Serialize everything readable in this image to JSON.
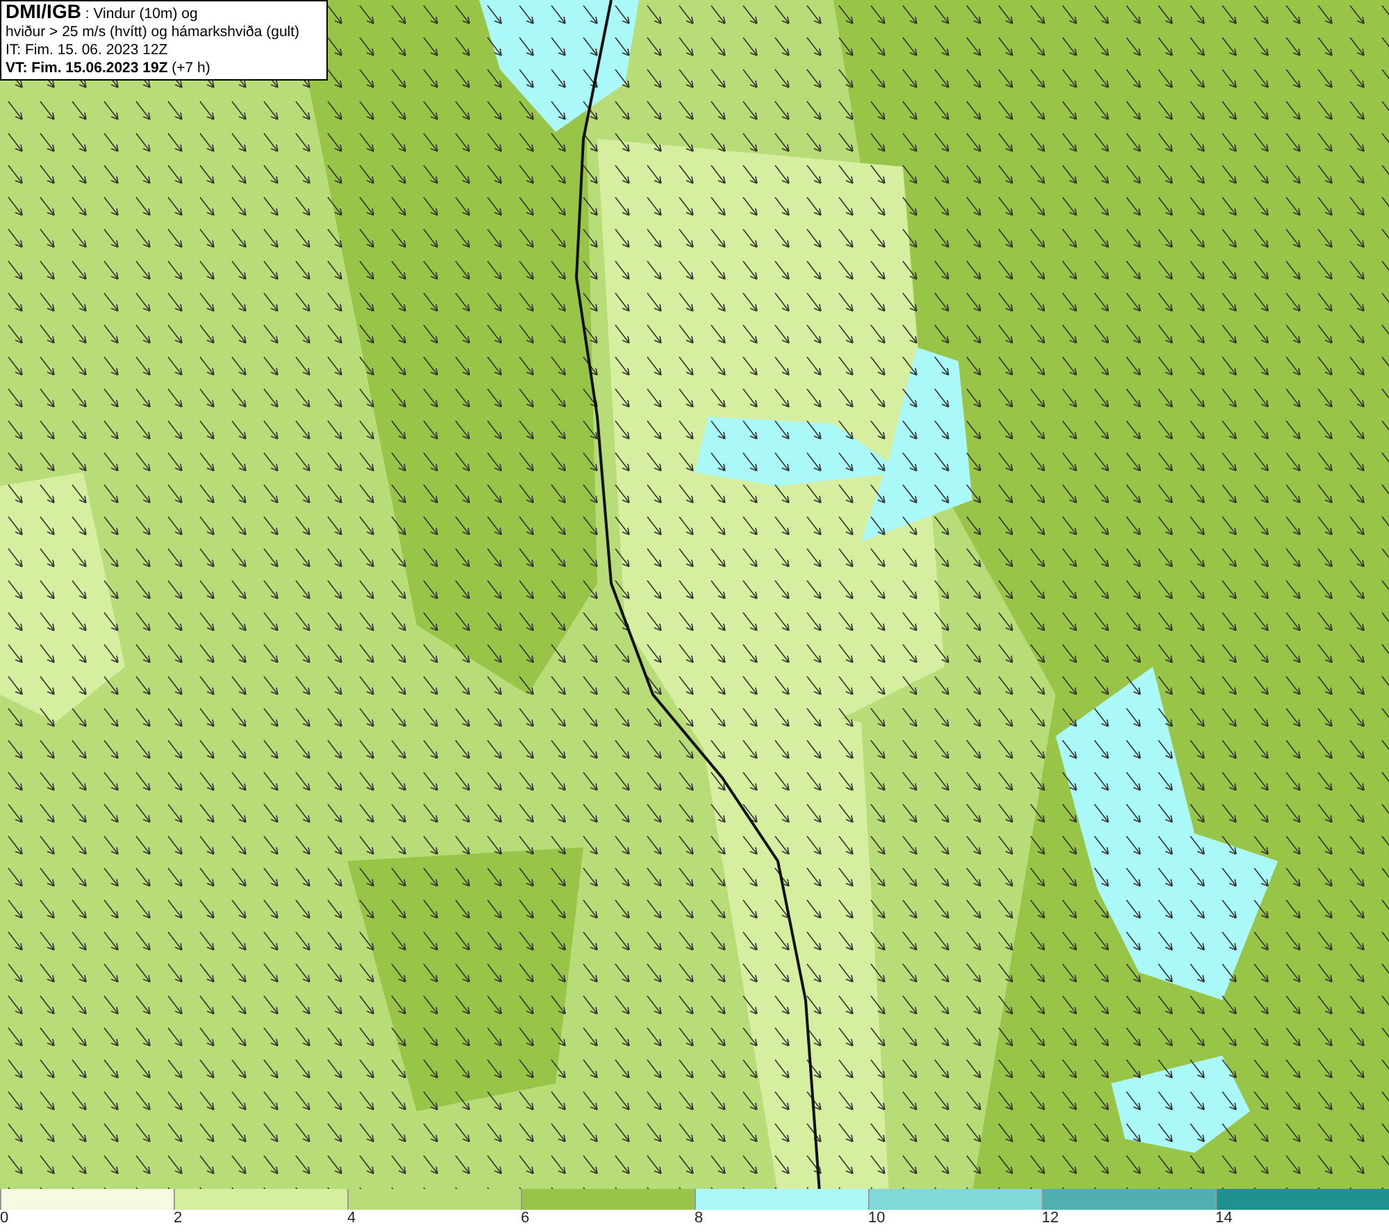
{
  "info_box": {
    "lines": [
      "**DMI/IGB** : Vindur (10m) og",
      "hviður > 25 m/s (hvítt) og hámarkshviða (gult)",
      "IT: Fim. 15. 06. 2023 12Z",
      "**VT: Fim. 15.06.2023 19Z** (+7 h)"
    ]
  },
  "legend": {
    "bins": [
      {
        "color": "#f5fbe0"
      },
      {
        "color": "#d6eea0"
      },
      {
        "color": "#b8dc78"
      },
      {
        "color": "#98c448"
      },
      {
        "color": "#aaf8f8"
      },
      {
        "color": "#80d8d8"
      },
      {
        "color": "#50b0b0"
      },
      {
        "color": "#209090"
      }
    ],
    "ticks": [
      "0",
      "2",
      "4",
      "6",
      "8",
      "10",
      "12",
      "14"
    ]
  }
}
